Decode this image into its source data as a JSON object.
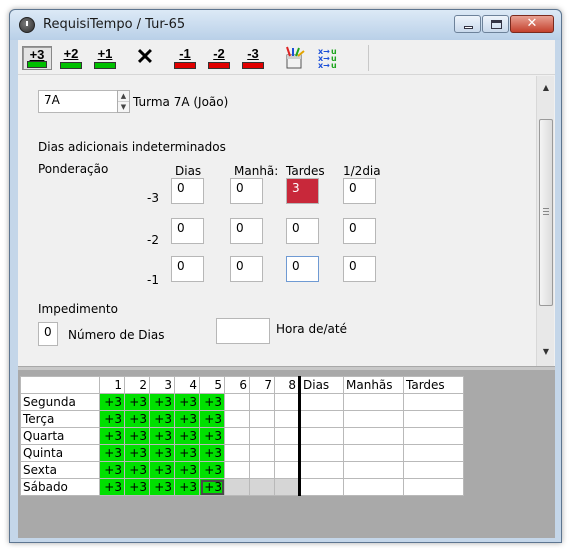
{
  "window": {
    "title": "RequisiTempo / Tur-65"
  },
  "toolbar": {
    "buttons": [
      {
        "label": "+3",
        "color": "#00c000"
      },
      {
        "label": "+2",
        "color": "#00c000"
      },
      {
        "label": "+1",
        "color": "#00c000"
      },
      {
        "label": "",
        "icon": "x-mark-icon"
      },
      {
        "label": "-1",
        "color": "#e00000"
      },
      {
        "label": "-2",
        "color": "#e00000"
      },
      {
        "label": "-3",
        "color": "#e00000"
      }
    ],
    "extra_icons": [
      "paint-cup-icon",
      "xyuv-icon"
    ]
  },
  "form": {
    "turma_code": "7A",
    "turma_name": "Turma 7A (João)",
    "dias_adicionais": "Dias adicionais indeterminados",
    "ponderacao_label": "Ponderação",
    "col_headers": [
      "Dias",
      "Manhã:",
      "Tardes",
      "1/2dia"
    ],
    "rows": [
      {
        "label": "-3",
        "values": [
          "0",
          "0",
          "3",
          "0"
        ]
      },
      {
        "label": "-2",
        "values": [
          "0",
          "0",
          "0",
          "0"
        ]
      },
      {
        "label": "-1",
        "values": [
          "0",
          "0",
          "0",
          "0"
        ]
      }
    ],
    "impedimento_label": "Impedimento",
    "numero_dias_value": "0",
    "numero_dias_label": "Número de Dias",
    "hora_value": "",
    "hora_label": "Hora de/até"
  },
  "grid": {
    "slot_headers": [
      "1",
      "2",
      "3",
      "4",
      "5",
      "6",
      "7",
      "8"
    ],
    "extra_headers": [
      "Dias",
      "Manhãs",
      "Tardes"
    ],
    "days": [
      {
        "name": "Segunda",
        "cells": [
          "+3",
          "+3",
          "+3",
          "+3",
          "+3",
          "",
          "",
          ""
        ]
      },
      {
        "name": "Terça",
        "cells": [
          "+3",
          "+3",
          "+3",
          "+3",
          "+3",
          "",
          "",
          ""
        ]
      },
      {
        "name": "Quarta",
        "cells": [
          "+3",
          "+3",
          "+3",
          "+3",
          "+3",
          "",
          "",
          ""
        ]
      },
      {
        "name": "Quinta",
        "cells": [
          "+3",
          "+3",
          "+3",
          "+3",
          "+3",
          "",
          "",
          ""
        ]
      },
      {
        "name": "Sexta",
        "cells": [
          "+3",
          "+3",
          "+3",
          "+3",
          "+3",
          "",
          "",
          ""
        ]
      },
      {
        "name": "Sábado",
        "cells": [
          "+3",
          "+3",
          "+3",
          "+3",
          "+3",
          "",
          "",
          ""
        ]
      }
    ],
    "highlight_color": "#00e000"
  }
}
